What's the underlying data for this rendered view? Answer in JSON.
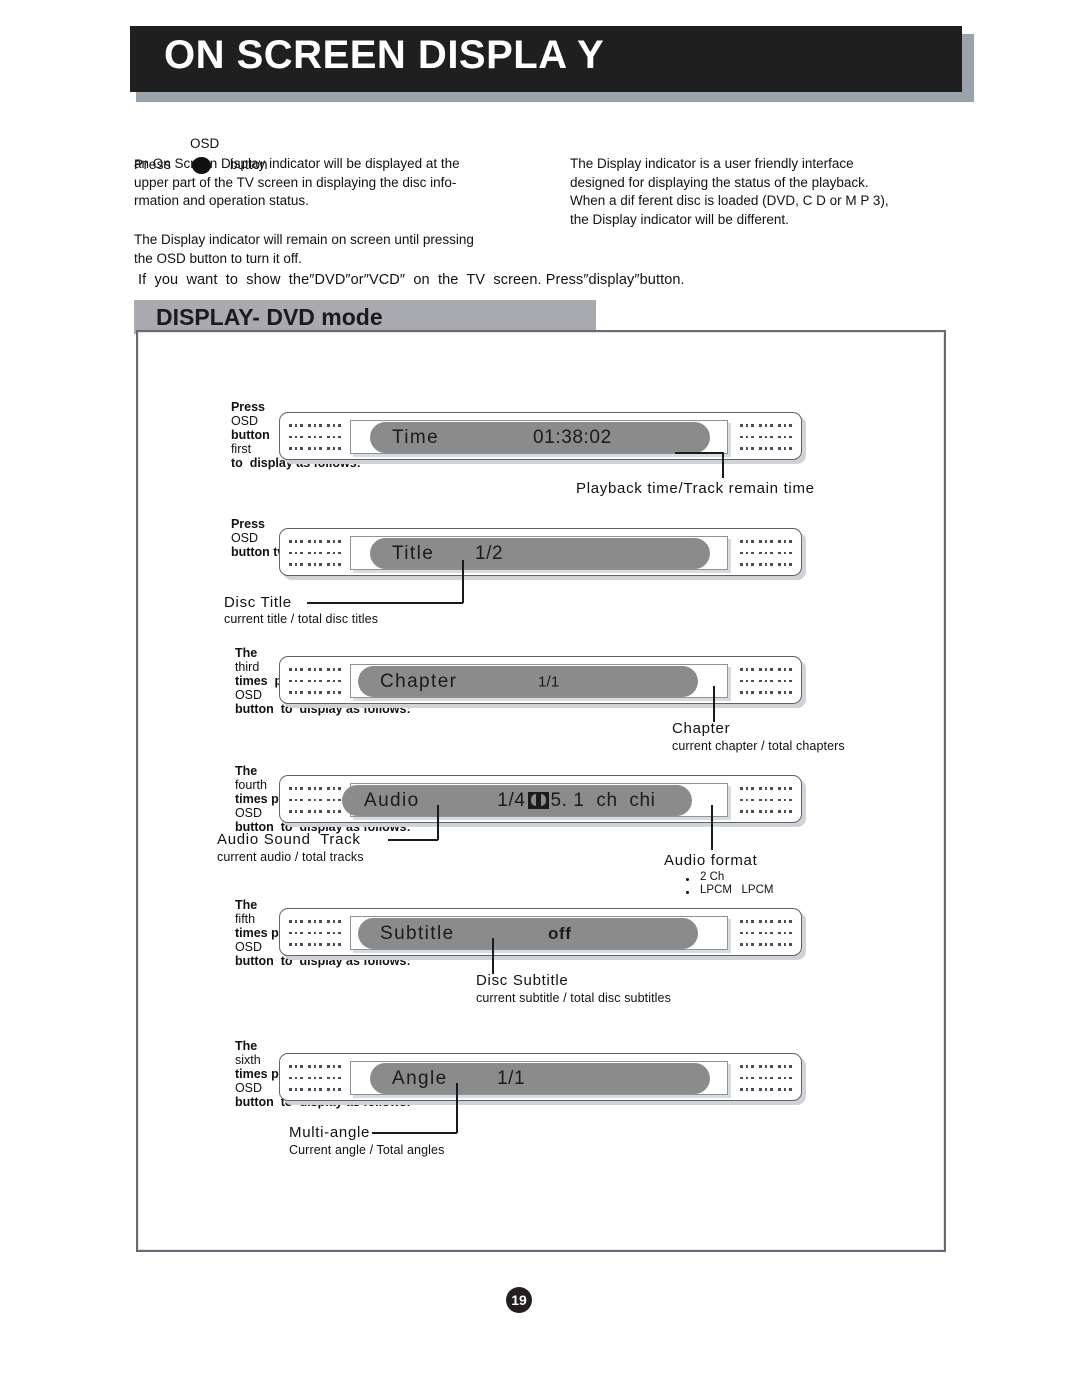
{
  "header": {
    "title": "ON SCREEN DISPLA Y"
  },
  "intro": {
    "osd_label": "OSD",
    "press_word": "Press",
    "button_word": "button",
    "left_paragraph": "an On Screen Display indicator will be displayed at the\nupper part of the TV screen in displaying the disc info-\nrmation and operation status.",
    "left_paragraph_2": "The Display indicator will remain on screen until pressing\nthe OSD button to turn it off.",
    "right_paragraph": "The Display indicator  is a user friendly interface\ndesigned for displaying the status of  the playback.\nWhen a dif ferent disc is  loaded (DVD, C D  or M P 3),\nthe Display indicator will be different.",
    "tv_line": "If  you  want  to  show  the″DVD″or″VCD″  on  the  TV  screen. Press″display″button."
  },
  "section": {
    "banner_title": "DISPLAY- DVD mode"
  },
  "steps": [
    {
      "id": "time",
      "label_bold_1": "Press",
      "label_thin_1": "OSD",
      "label_bold_2": "button",
      "label_thin_2": "first",
      "label_bold_3": "to  display as follows:",
      "pill_name": "Time",
      "pill_value": "01:38:02",
      "callout_title": "Playback time/Track remain time",
      "callout_sub": ""
    },
    {
      "id": "title",
      "label_bold_1": "Press",
      "label_thin_1": "OSD",
      "label_bold_2": "button twice  times  to  display as follows:",
      "pill_name": "Title",
      "pill_value": "1/2",
      "callout_title": "Disc Title",
      "callout_sub": "current title / total disc titles"
    },
    {
      "id": "chapter",
      "label_bold_1": "The",
      "label_thin_1": "third",
      "label_bold_2": "times  press",
      "label_thin_2": "OSD",
      "label_bold_3": "button  to  display as follows:",
      "pill_name": "Chapter",
      "pill_value": "1/1",
      "callout_title": "Chapter",
      "callout_sub": "current chapter / total chapters"
    },
    {
      "id": "audio",
      "label_bold_1": "The",
      "label_thin_1": "fourth",
      "label_bold_2": "times press",
      "label_thin_2": "OSD",
      "label_bold_3": "button  to  display as follows:",
      "pill_name": "Audio",
      "pill_value_prefix": "1/4",
      "pill_value_suffix": "5. 1  ch  chi",
      "callout_title": "Audio Sound  Track",
      "callout_sub": "current audio / total tracks",
      "callout_title_2": "Audio format",
      "bullets": [
        "2 Ch",
        "LPCM   LPCM"
      ]
    },
    {
      "id": "subtitle",
      "label_bold_1": "The",
      "label_thin_1": "fifth",
      "label_bold_2": "times press",
      "label_thin_2": "OSD",
      "label_bold_3": "button  to  display as follows:",
      "pill_name": "Subtitle",
      "pill_value": "off",
      "callout_title": "Disc Subtitle",
      "callout_sub": "current subtitle / total disc subtitles"
    },
    {
      "id": "angle",
      "label_bold_1": "The",
      "label_thin_1": "sixth",
      "label_bold_2": "times press",
      "label_thin_2": "OSD",
      "label_bold_3": "button  to  display as follows:",
      "pill_name": "Angle",
      "pill_value": "1/1",
      "callout_title": "Multi-angle",
      "callout_sub": "Current angle / Total angles"
    }
  ],
  "footer": {
    "page_number": "19"
  },
  "colors": {
    "header_bg": "#1f1f1f",
    "header_shadow": "#9aa2ab",
    "banner_bg": "#a8aab0",
    "pill_bg": "#8b8b8b",
    "box_border": "#666b73"
  }
}
